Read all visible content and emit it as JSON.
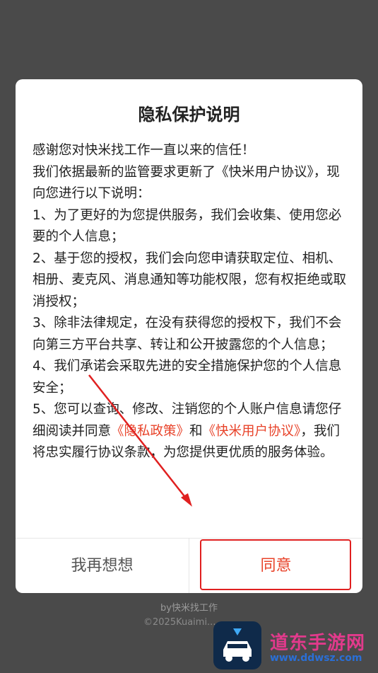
{
  "dialog": {
    "title": "隐私保护说明",
    "paragraphs": {
      "p1": "感谢您对快米找工作一直以来的信任！",
      "p2": "我们依据最新的监管要求更新了《快米用户协议》，现向您进行以下说明：",
      "p3": "1、为了更好的为您提供服务，我们会收集、使用您必要的个人信息；",
      "p4": "2、基于您的授权，我们会向您申请获取定位、相机、相册、麦克风、消息通知等功能权限，您有权拒绝或取消授权；",
      "p5": "3、除非法律规定，在没有获得您的授权下，我们不会向第三方平台共享、转让和公开披露您的个人信息；",
      "p6": "4、我们承诺会采取先进的安全措施保护您的个人信息安全；",
      "p7_intro": "5、您可以查询、修改、注销您的个人账户信息请您仔细阅读并同意",
      "p7_link1": "《隐私政策》",
      "p7_and": "和",
      "p7_link2": "《快米用户协议》",
      "p7_outro": "，我们将忠实履行协议条款，为您提供更优质的服务体验。"
    },
    "buttons": {
      "cancel": "我再想想",
      "agree": "同意"
    }
  },
  "footer": {
    "line1": "by快米找工作",
    "line2": "©2025Kuaimi..."
  },
  "watermark": {
    "text": "道东手游网",
    "sub": "www.ddwsz.com"
  },
  "colors": {
    "link": "#e8432a",
    "highlight": "#e02020",
    "overlay": "#4a4a4a"
  }
}
